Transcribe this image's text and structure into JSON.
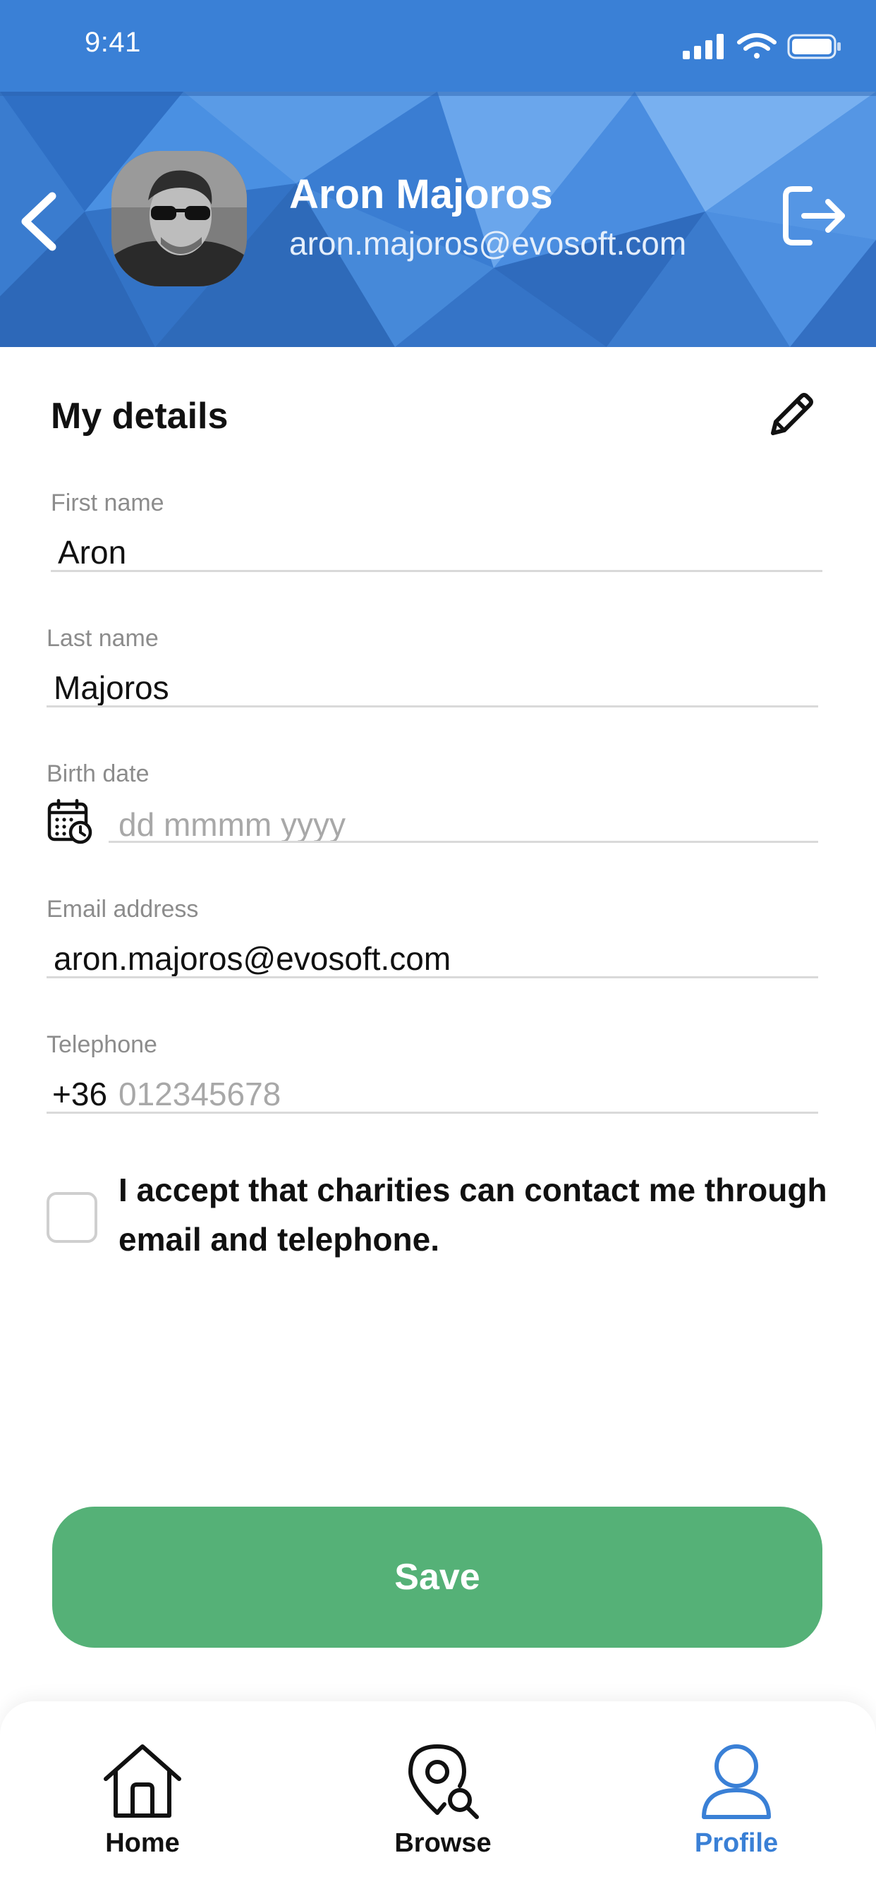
{
  "status_bar": {
    "time": "9:41"
  },
  "profile": {
    "name": "Aron Majoros",
    "email": "aron.majoros@evosoft.com"
  },
  "details": {
    "title": "My details",
    "first_name": {
      "label": "First name",
      "value": "Aron"
    },
    "last_name": {
      "label": "Last name",
      "value": "Majoros"
    },
    "birth_date": {
      "label": "Birth date",
      "placeholder": "dd mmmm yyyy"
    },
    "email": {
      "label": "Email address",
      "value": "aron.majoros@evosoft.com"
    },
    "telephone": {
      "label": "Telephone",
      "prefix": "+36",
      "placeholder": "012345678"
    },
    "consent": {
      "text": "I accept that charities can contact me through email and telephone.",
      "checked": false
    }
  },
  "actions": {
    "save_label": "Save"
  },
  "tabs": [
    {
      "label": "Home",
      "icon": "home-icon",
      "active": false
    },
    {
      "label": "Browse",
      "icon": "map-search-icon",
      "active": false
    },
    {
      "label": "Profile",
      "icon": "person-icon",
      "active": true
    }
  ],
  "colors": {
    "header_blue": "#3b83d8",
    "save_green": "#55b177",
    "active_tab": "#3a80d6"
  }
}
